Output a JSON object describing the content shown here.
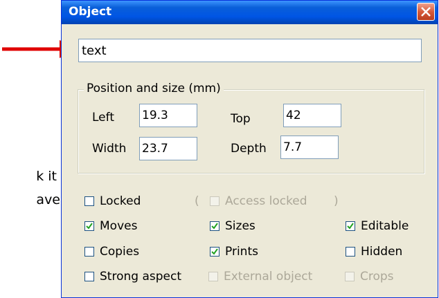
{
  "background": {
    "line1": "k it",
    "line2": "ave"
  },
  "dialog": {
    "title": "Object",
    "close_icon": "close-icon",
    "name_value": "text",
    "position_group": {
      "legend": "Position and size (mm)",
      "left_label": "Left",
      "left_value": "19.3",
      "top_label": "Top",
      "top_value": "42",
      "width_label": "Width",
      "width_value": "23.7",
      "depth_label": "Depth",
      "depth_value": "7.7"
    },
    "options": {
      "locked": {
        "label": "Locked",
        "checked": false,
        "enabled": true
      },
      "access_locked": {
        "label": "Access locked",
        "checked": false,
        "enabled": false
      },
      "paren_open": "(",
      "paren_close": ")",
      "moves": {
        "label": "Moves",
        "checked": true,
        "enabled": true
      },
      "sizes": {
        "label": "Sizes",
        "checked": true,
        "enabled": true
      },
      "editable": {
        "label": "Editable",
        "checked": true,
        "enabled": true
      },
      "copies": {
        "label": "Copies",
        "checked": false,
        "enabled": true
      },
      "prints": {
        "label": "Prints",
        "checked": true,
        "enabled": true
      },
      "hidden": {
        "label": "Hidden",
        "checked": false,
        "enabled": true
      },
      "strong_aspect": {
        "label": "Strong aspect",
        "checked": false,
        "enabled": true
      },
      "external_object": {
        "label": "External object",
        "checked": false,
        "enabled": false
      },
      "crops": {
        "label": "Crops",
        "checked": false,
        "enabled": false
      }
    }
  },
  "colors": {
    "arrow": "#e00000",
    "titlebar": "#0055e5",
    "dialog_bg": "#ece9d8"
  }
}
